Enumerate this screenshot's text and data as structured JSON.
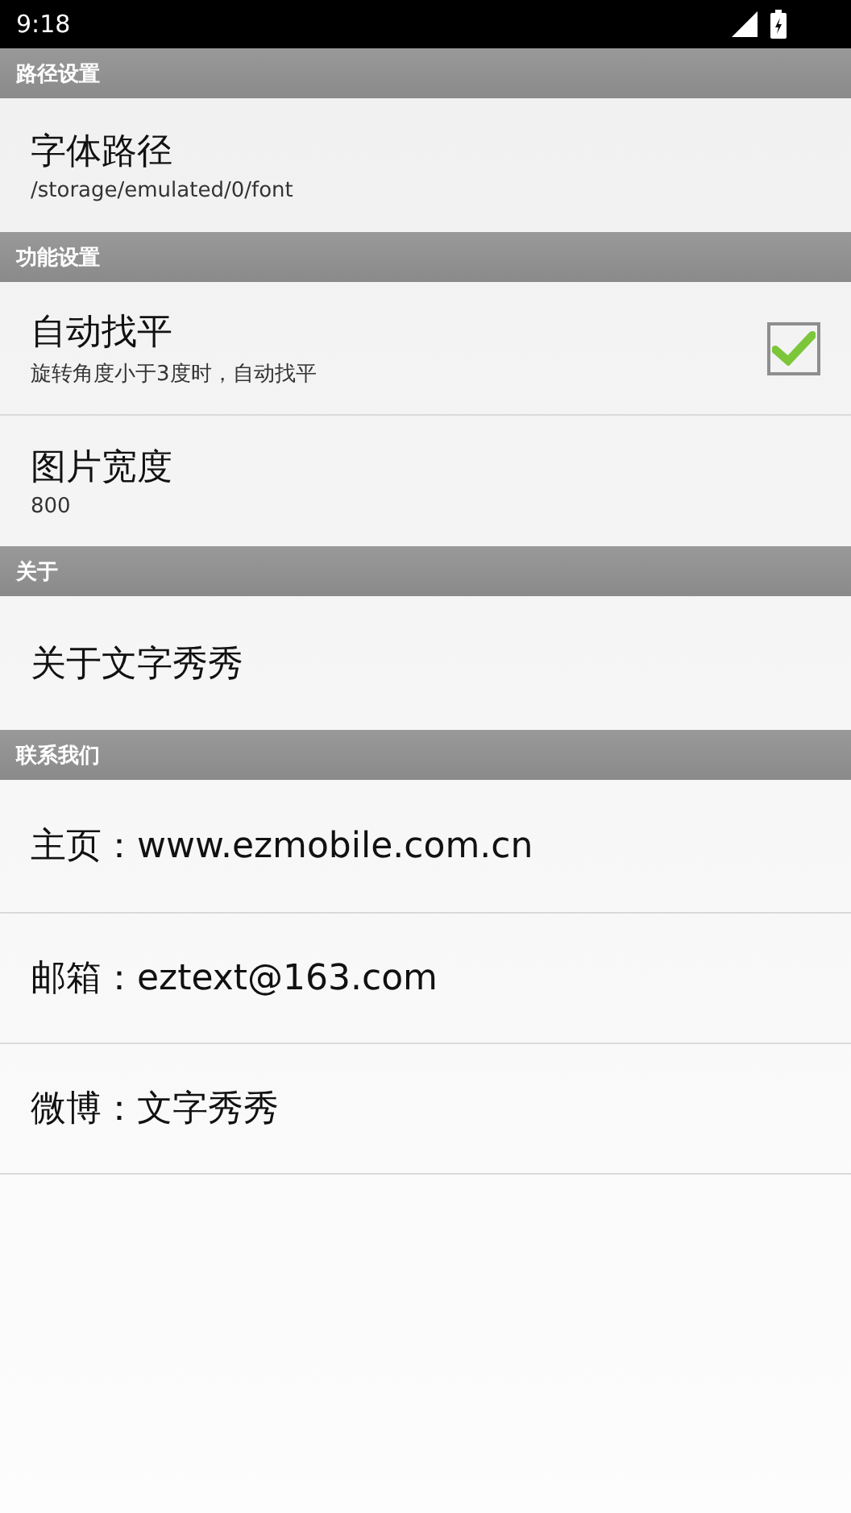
{
  "status_bar": {
    "time": "9:18"
  },
  "sections": [
    {
      "title": "路径设置",
      "items": [
        {
          "kind": "text",
          "title": "字体路径",
          "summary": "/storage/emulated/0/font"
        }
      ]
    },
    {
      "title": "功能设置",
      "items": [
        {
          "kind": "checkbox",
          "title": "自动找平",
          "summary": "旋转角度小于3度时，自动找平",
          "checked": true
        },
        {
          "kind": "text",
          "title": "图片宽度",
          "summary": "800"
        }
      ]
    },
    {
      "title": "关于",
      "items": [
        {
          "kind": "text",
          "title": "关于文字秀秀"
        }
      ]
    },
    {
      "title": "联系我们",
      "items": [
        {
          "kind": "text",
          "title": "主页：www.ezmobile.com.cn"
        },
        {
          "kind": "text",
          "title": "邮箱：eztext@163.com"
        },
        {
          "kind": "text",
          "title": "微博：文字秀秀"
        }
      ]
    }
  ]
}
